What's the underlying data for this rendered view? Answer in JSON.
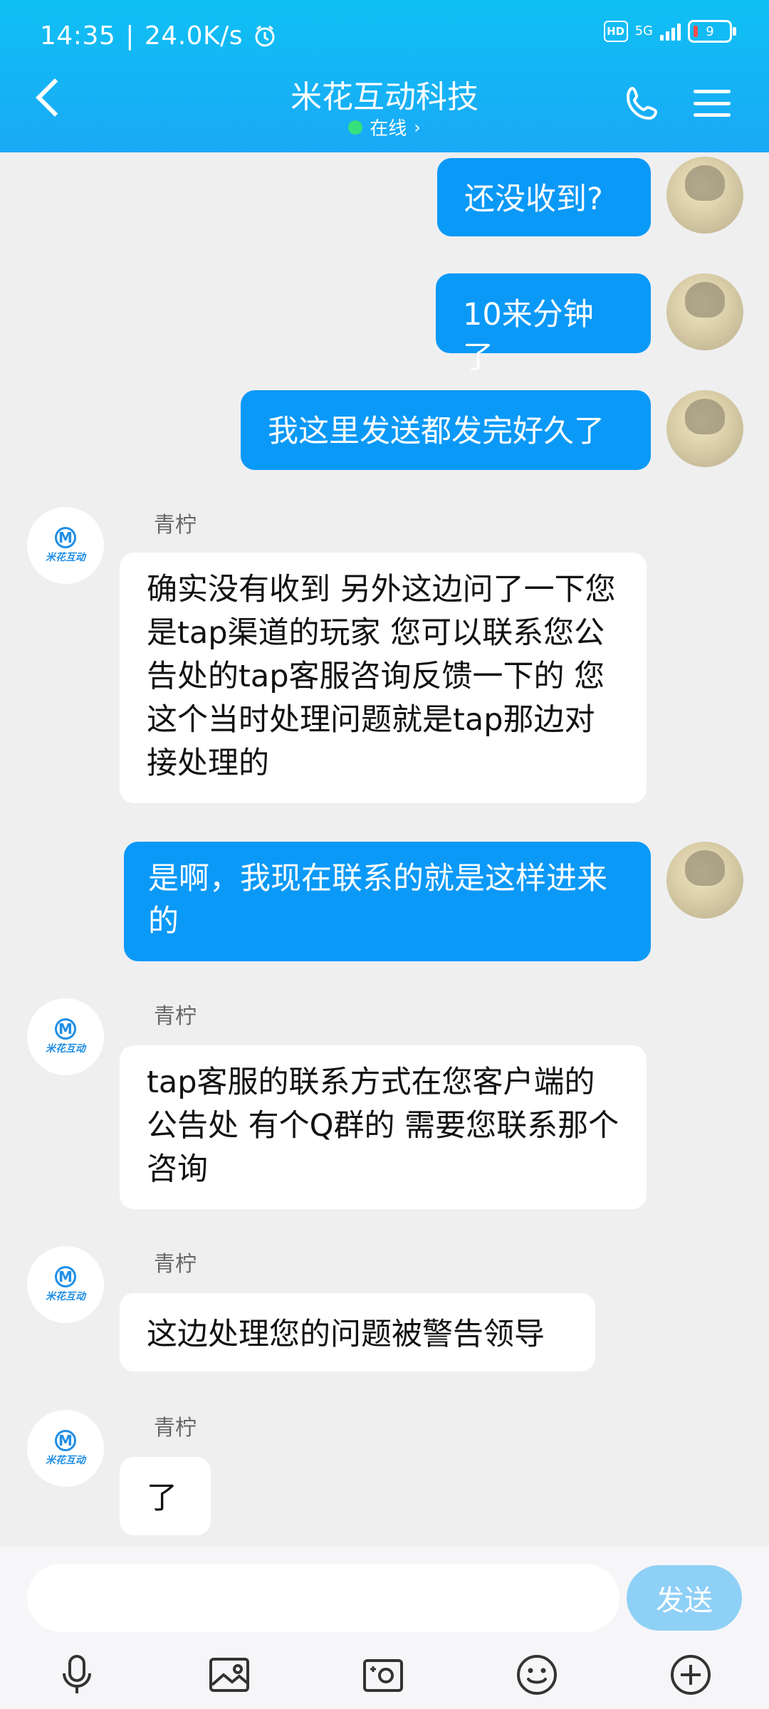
{
  "status_bar": {
    "time": "14:35",
    "speed": "24.0K/s",
    "hd": "HD",
    "network": "5G",
    "battery": "9"
  },
  "header": {
    "title": "米花互动科技",
    "presence": "在线"
  },
  "messages": [
    {
      "side": "me",
      "text": "还没收到?"
    },
    {
      "side": "me",
      "text": "10来分钟了"
    },
    {
      "side": "me",
      "text": "我这里发送都发完好久了"
    },
    {
      "side": "them",
      "sender": "青柠",
      "text": "确实没有收到 另外这边问了一下您是tap渠道的玩家 您可以联系您公告处的tap客服咨询反馈一下的 您这个当时处理问题就是tap那边对接处理的"
    },
    {
      "side": "me",
      "text": "是啊，我现在联系的就是这样进来的"
    },
    {
      "side": "them",
      "sender": "青柠",
      "text": "tap客服的联系方式在您客户端的公告处 有个Q群的 需要您联系那个咨询"
    },
    {
      "side": "them",
      "sender": "青柠",
      "text": "这边处理您的问题被警告领导"
    },
    {
      "side": "them",
      "sender": "青柠",
      "text": "了"
    }
  ],
  "avatar_them": {
    "logo_letter": "M",
    "logo_text": "米花互动"
  },
  "composer": {
    "placeholder": "",
    "send_label": "发送"
  },
  "toolbar": [
    "microphone-icon",
    "image-icon",
    "camera-icon",
    "emoji-icon",
    "plus-icon"
  ]
}
